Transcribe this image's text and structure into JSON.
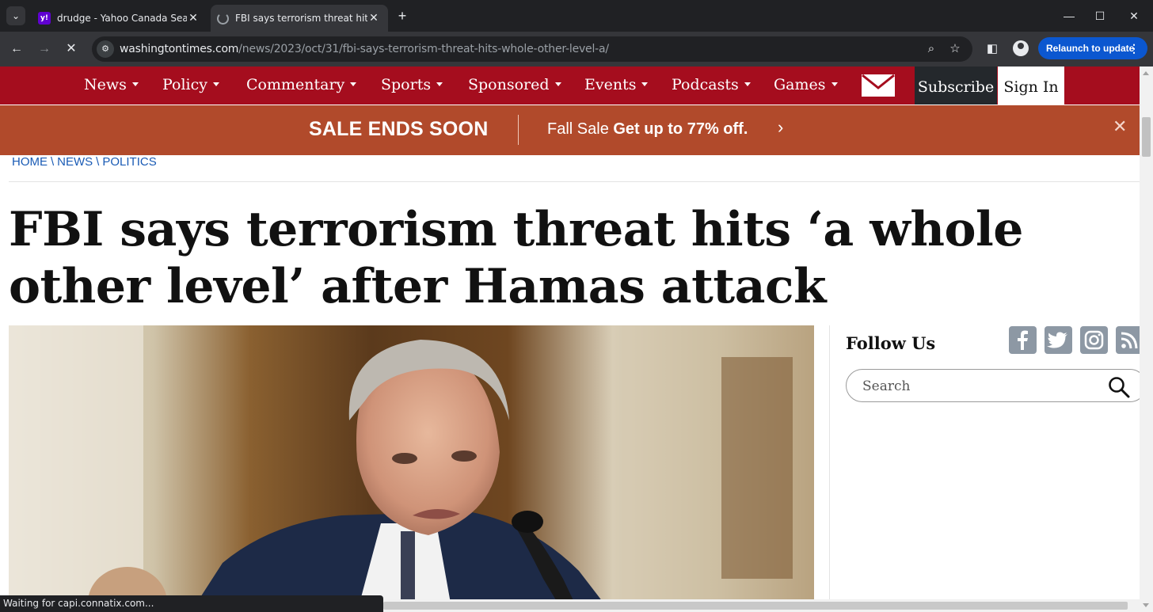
{
  "browser": {
    "tabs": [
      {
        "title": "drudge - Yahoo Canada Search",
        "favicon": "yahoo-icon",
        "active": false
      },
      {
        "title": "FBI says terrorism threat hits 'a whole other level' after Hamas attack",
        "favicon": "loading-spinner-icon",
        "active": true
      }
    ],
    "url_host": "washingtontimes.com",
    "url_path": "/news/2023/oct/31/fbi-says-terrorism-threat-hits-whole-other-level-a/",
    "relaunch_label": "Relaunch to update",
    "status_text": "Waiting for capi.connatix.com..."
  },
  "site": {
    "nav": [
      {
        "label": "News"
      },
      {
        "label": "Policy"
      },
      {
        "label": "Commentary"
      },
      {
        "label": "Sports"
      },
      {
        "label": "Sponsored"
      },
      {
        "label": "Events"
      },
      {
        "label": "Podcasts"
      },
      {
        "label": "Games"
      }
    ],
    "subscribe_label": "Subscribe",
    "signin_label": "Sign In",
    "brand_color": "#a50d1e",
    "sale": {
      "headline": "SALE ENDS SOON",
      "text_prefix": "Fall Sale ",
      "text_bold": "Get up to 77% off.",
      "color": "#b14a2b"
    },
    "breadcrumb": [
      "HOME",
      "NEWS",
      "POLITICS"
    ],
    "headline": "FBI says terrorism threat hits ‘a whole other level’ after Hamas attack",
    "sidebar": {
      "follow_label": "Follow Us",
      "social": [
        "facebook-icon",
        "twitter-icon",
        "instagram-icon",
        "rss-icon"
      ],
      "search_placeholder": "Search"
    }
  }
}
